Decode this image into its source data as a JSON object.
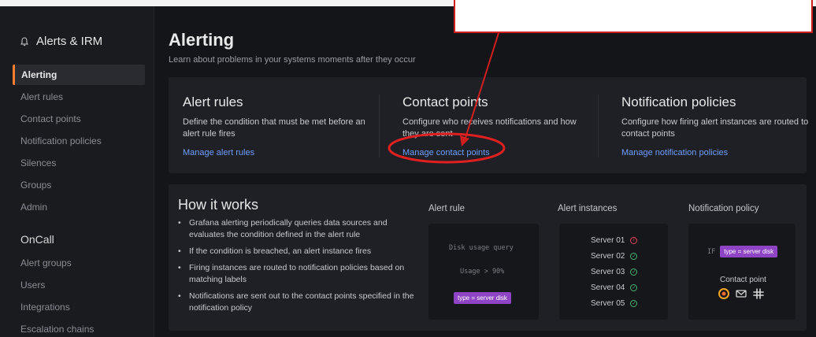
{
  "sidebar": {
    "title": "Alerts & IRM",
    "items": [
      {
        "label": "Alerting",
        "active": true
      },
      {
        "label": "Alert rules"
      },
      {
        "label": "Contact points"
      },
      {
        "label": "Notification policies"
      },
      {
        "label": "Silences"
      },
      {
        "label": "Groups"
      },
      {
        "label": "Admin"
      }
    ],
    "section": "OnCall",
    "oncall_items": [
      {
        "label": "Alert groups"
      },
      {
        "label": "Users"
      },
      {
        "label": "Integrations"
      },
      {
        "label": "Escalation chains"
      }
    ]
  },
  "main": {
    "title": "Alerting",
    "subtitle": "Learn about problems in your systems moments after they occur",
    "cards": [
      {
        "title": "Alert rules",
        "desc": "Define the condition that must be met before an alert rule fires",
        "link": "Manage alert rules"
      },
      {
        "title": "Contact points",
        "desc": "Configure who receives notifications and how they are sent",
        "link": "Manage contact points"
      },
      {
        "title": "Notification policies",
        "desc": "Configure how firing alert instances are routed to contact points",
        "link": "Manage notification policies"
      }
    ],
    "how": {
      "title": "How it works",
      "bullets": [
        "Grafana alerting periodically queries data sources and evaluates the condition defined in the alert rule",
        "If the condition is breached, an alert instance fires",
        "Firing instances are routed to notification policies based on matching labels",
        "Notifications are sent out to the contact points specified in the notification policy"
      ],
      "diagram": {
        "alert_rule_label": "Alert rule",
        "alert_instances_label": "Alert instances",
        "notification_policy_label": "Notification policy",
        "query": "Disk usage query",
        "condition": "Usage > 90%",
        "tag": "type = server disk",
        "servers": [
          {
            "name": "Server 01",
            "firing": true
          },
          {
            "name": "Server 02",
            "firing": false
          },
          {
            "name": "Server 03",
            "firing": false
          },
          {
            "name": "Server 04",
            "firing": false
          },
          {
            "name": "Server 05",
            "firing": false
          }
        ],
        "if_keyword": "IF",
        "contact_point_label": "Contact point"
      }
    }
  },
  "colors": {
    "accent": "#ff7c2a",
    "link": "#6e9fff",
    "tag": "#8e44c4",
    "ok": "#4ab471",
    "firing": "#e0445a",
    "annotation": "#d11f1f"
  },
  "icons": [
    "bell-icon",
    "grafana-oncall-icon",
    "email-icon",
    "slack-icon"
  ]
}
